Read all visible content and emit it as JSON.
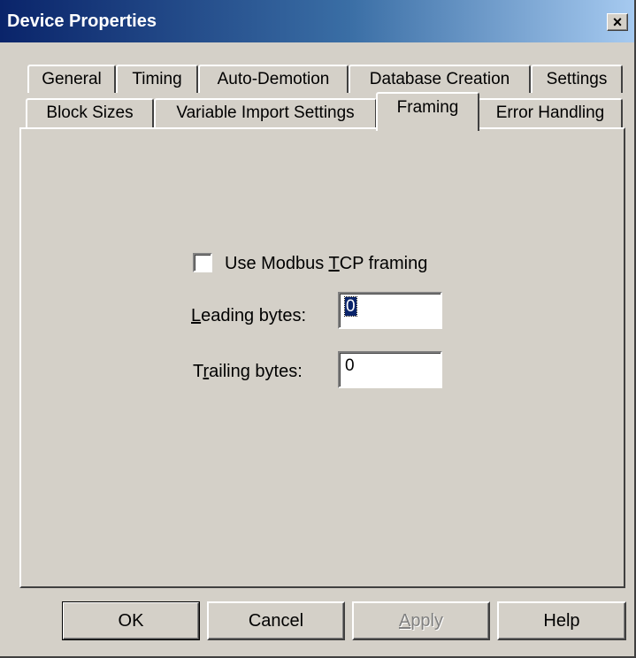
{
  "window": {
    "title": "Device Properties",
    "close_glyph": "×"
  },
  "tabs": {
    "row1": [
      {
        "label": "General"
      },
      {
        "label": "Timing"
      },
      {
        "label": "Auto-Demotion"
      },
      {
        "label": "Database Creation"
      },
      {
        "label": "Settings"
      }
    ],
    "row2": [
      {
        "label": "Block Sizes"
      },
      {
        "label": "Variable Import Settings"
      },
      {
        "label": "Framing",
        "active": true
      },
      {
        "label": "Error Handling"
      }
    ]
  },
  "framing": {
    "checkbox_label_pre": "Use Modbus ",
    "checkbox_label_ul": "T",
    "checkbox_label_post": "CP framing",
    "checkbox_checked": false,
    "leading_label_ul": "L",
    "leading_label_rest": "eading bytes:",
    "leading_value": "0",
    "trailing_label_pre": "T",
    "trailing_label_ul": "r",
    "trailing_label_rest": "ailing bytes:",
    "trailing_value": "0"
  },
  "buttons": {
    "ok": "OK",
    "cancel": "Cancel",
    "apply_ul": "A",
    "apply_rest": "pply",
    "help": "Help"
  }
}
